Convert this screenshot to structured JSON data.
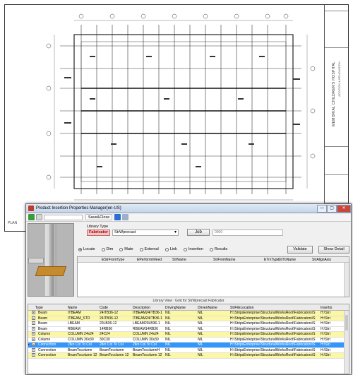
{
  "sheet": {
    "titleblock_text": "MEMORIAL CHILDREN'S HOSPITAL",
    "titleblock_sub": "ADDITION & RENOVATION",
    "corner_label": "PLAN"
  },
  "window": {
    "title": "Product Insertion Properties Manager(en-US)",
    "controls": {
      "minimize": "—",
      "maximize": "▢",
      "close": "✕"
    }
  },
  "toolbar": {
    "save_label": "Save&Close",
    "field_value": ""
  },
  "library": {
    "type_label": "Library Type",
    "fabricator_label": "Fabricator",
    "selected_library": "StrWprecast",
    "job_button": "Job",
    "job_value": "0000"
  },
  "radios": [
    {
      "label": "Locate",
      "selected": true
    },
    {
      "label": "Dim",
      "selected": false
    },
    {
      "label": "Mate",
      "selected": false
    },
    {
      "label": "External",
      "selected": false
    },
    {
      "label": "Link",
      "selected": false
    },
    {
      "label": "Insertion",
      "selected": false
    },
    {
      "label": "Results",
      "selected": false
    }
  ],
  "buttons": {
    "validate": "Validate",
    "show_detail": "Show Detail"
  },
  "props_grid": {
    "columns": [
      "EStrFromType",
      "EPerformInfeed",
      "StrName",
      "StrFromName",
      "ETrxType",
      "StrToName",
      "StrAlignAxis"
    ]
  },
  "library_view": {
    "header": "Library View : Grid for StrWprecast Fabricator",
    "columns": [
      "Type",
      "Name",
      "Code",
      "Description",
      "DrivingName",
      "DrivenName",
      "StrFileLocation",
      "Insertio"
    ],
    "rows": [
      {
        "type": "Beam",
        "name": "ITBEAM",
        "code": "24ITB36-12",
        "description": "ITBEAM24ITB36-1",
        "driving": "NIL",
        "driven": "NIL",
        "location": "H:\\StripsEnterprise\\StructuralWorksRoot\\Fabricators\\S",
        "insertion": "H:\\Stri",
        "style": "yellow",
        "expander": "+"
      },
      {
        "type": "Beam",
        "name": "ITBEAM_STD",
        "code": "24ITB36-12",
        "description": "ITBEAM24ITB36-1",
        "driving": "NIL",
        "driven": "NIL",
        "location": "H:\\StripsEnterprise\\StructuralWorksRoot\\Fabricators\\S",
        "insertion": "H:\\Stri",
        "style": "yellow",
        "expander": "+"
      },
      {
        "type": "Beam",
        "name": "LBEAM",
        "code": "20LB36-12",
        "description": "LBEAM20LB36-1",
        "driving": "NIL",
        "driven": "NIL",
        "location": "H:\\StripsEnterprise\\StructuralWorksRoot\\Fabricators\\S",
        "insertion": "H:\\Stri",
        "style": "white",
        "expander": "+"
      },
      {
        "type": "Beam",
        "name": "RBEAM",
        "code": "14RB36",
        "description": "RBEAM14RB36",
        "driving": "NIL",
        "driven": "NIL",
        "location": "H:\\StripsEnterprise\\StructuralWorksRoot\\Fabricators\\S",
        "insertion": "H:\\Stri",
        "style": "white",
        "expander": "+"
      },
      {
        "type": "Column",
        "name": "COLUMN 24x24",
        "code": "24C24",
        "description": "COLUMN 24x24",
        "driving": "NIL",
        "driven": "NIL",
        "location": "H:\\StripsEnterprise\\StructuralWorksRoot\\Fabricators\\S",
        "insertion": "H:\\Stri",
        "style": "yellow",
        "expander": "+"
      },
      {
        "type": "Column",
        "name": "COLUMN 30x30",
        "code": "30C30",
        "description": "COLUMN 30x30",
        "driving": "NIL",
        "driven": "NIL",
        "location": "H:\\StripsEnterprise\\StructuralWorksRoot\\Fabricators\\S",
        "insertion": "H:\\Stri",
        "style": "white",
        "expander": "+"
      },
      {
        "type": "Connection",
        "name": "2Ikn Col To Col",
        "code": "2Ikn Col To Col",
        "description": "2Ikn Col To Col",
        "driving": "NIL",
        "driven": "NIL",
        "location": "H:\\StripsEnterprise\\StructuralWorksRoot\\Fabricators\\S",
        "insertion": "H:\\Stri",
        "style": "sel",
        "expander": "+"
      },
      {
        "type": "Connection",
        "name": "BeamTocolumn",
        "code": "BeamTocolumn",
        "description": "BeamTocolumnH",
        "driving": "NIL",
        "driven": "NIL",
        "location": "H:\\StripsEnterprise\\StructuralWorksRoot\\Fabricators\\S",
        "insertion": "H:\\Stri",
        "style": "white",
        "expander": "+"
      },
      {
        "type": "Connection",
        "name": "BeamTocolumn 12",
        "code": "BeamTocolumn 12",
        "description": "BeamTocolumn 12",
        "driving": "NIL",
        "driven": "NIL",
        "location": "H:\\StripsEnterprise\\StructuralWorksRoot\\Fabricators\\S",
        "insertion": "H:\\Stri",
        "style": "yellow",
        "expander": "+"
      }
    ]
  },
  "colors": {
    "row_yellow": "#fbf7a4",
    "row_selected": "#3297fd",
    "fabricator_bg": "#f0c6c6",
    "plate": "#c68b2e"
  }
}
